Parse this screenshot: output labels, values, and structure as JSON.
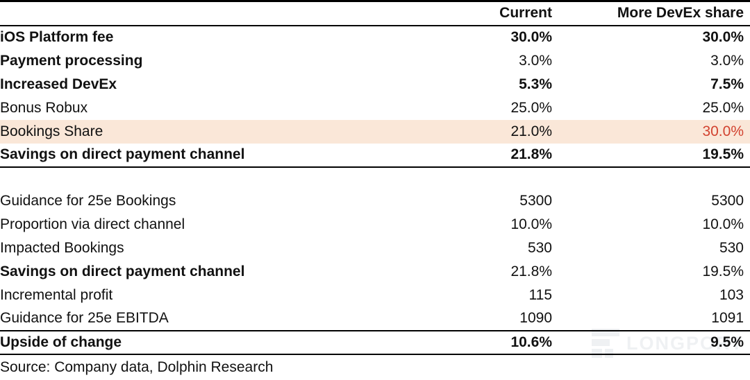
{
  "table": {
    "columns": [
      {
        "key": "label",
        "header": ""
      },
      {
        "key": "current",
        "header": "Current"
      },
      {
        "key": "more",
        "header": "More DevEx share"
      }
    ],
    "section_one": [
      {
        "label": "iOS Platform fee",
        "current": "30.0%",
        "more": "30.0%"
      },
      {
        "label": "Payment processing",
        "current": "3.0%",
        "more": "3.0%"
      },
      {
        "label": "Increased DevEx",
        "current": "5.3%",
        "more": "7.5%"
      },
      {
        "label": "Bonus Robux",
        "current": "25.0%",
        "more": "25.0%"
      },
      {
        "label": "Bookings Share",
        "current": "21.0%",
        "more": "30.0%"
      },
      {
        "label": "Savings on direct payment channel",
        "current": "21.8%",
        "more": "19.5%"
      }
    ],
    "section_two": [
      {
        "label": "Guidance for 25e Bookings",
        "current": "5300",
        "more": "5300"
      },
      {
        "label": "Proportion via direct channel",
        "current": "10.0%",
        "more": "10.0%"
      },
      {
        "label": "Impacted Bookings",
        "current": "530",
        "more": "530"
      },
      {
        "label": "Savings on direct payment channel",
        "current": "21.8%",
        "more": "19.5%"
      },
      {
        "label": "Incremental profit",
        "current": "115",
        "more": "103"
      },
      {
        "label": "Guidance for 25e EBITDA",
        "current": "1090",
        "more": "1091"
      },
      {
        "label": "Upside of change",
        "current": "10.6%",
        "more": "9.5%"
      }
    ],
    "source": "Source: Company data, Dolphin Research"
  },
  "watermark": {
    "text": "LONGPORT",
    "mark": "longport-logo-icon"
  },
  "colors": {
    "highlight_background": "#FAE7D8",
    "highlight_value": "#D2422F",
    "rule": "#000000",
    "text": "#111111"
  }
}
